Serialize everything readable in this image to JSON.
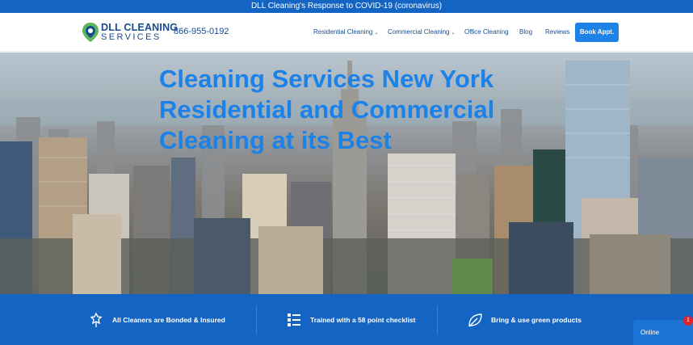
{
  "announcement": "DLL Cleaning's Response to COVID-19 (coronavirus)",
  "logo": {
    "line1": "DLL CLEANING",
    "line2": "SERVICES"
  },
  "phone": "866-955-0192",
  "nav": {
    "items": [
      {
        "label": "Residential Cleaning",
        "has_dropdown": true
      },
      {
        "label": "Commercial Cleaning",
        "has_dropdown": true
      },
      {
        "label": "Office Cleaning",
        "has_dropdown": false
      },
      {
        "label": "Blog",
        "has_dropdown": false
      },
      {
        "label": "Reviews",
        "has_dropdown": false
      }
    ],
    "chevron": "⌄",
    "book_button": "Book Appt."
  },
  "hero": {
    "lines": [
      "Cleaning Services New York",
      "Residential and Commercial",
      "Cleaning at its Best"
    ]
  },
  "features": [
    {
      "text": "All Cleaners are Bonded & Insured",
      "icon": "badge-icon"
    },
    {
      "text": "Trained with a 58 point checklist",
      "icon": "checklist-icon"
    },
    {
      "text": "Bring & use green products",
      "icon": "leaf-icon"
    }
  ],
  "chat": {
    "label": "Online",
    "badge": "1"
  },
  "colors": {
    "brand_blue": "#1464c4",
    "accent_blue": "#1c82e8",
    "logo_navy": "#1a4c8c",
    "logo_green": "#5cb85c",
    "badge_red": "#d9262a"
  }
}
